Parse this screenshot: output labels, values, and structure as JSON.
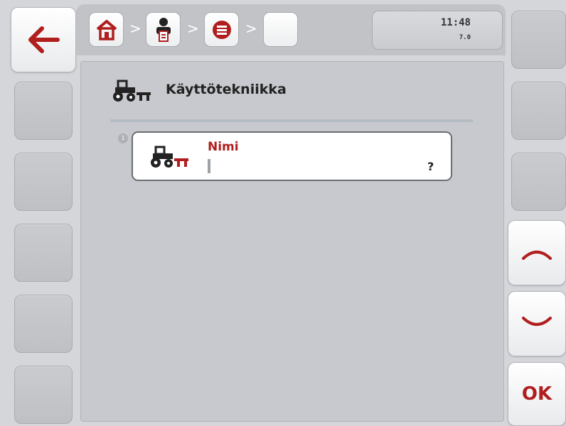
{
  "header": {
    "clock_time": "11:48",
    "version": "7.0"
  },
  "breadcrumb": {
    "items": [
      "home-icon",
      "operator-icon",
      "list-icon",
      "empty"
    ],
    "separator": ">"
  },
  "section": {
    "title": "Käyttötekniikka",
    "icon": "tractor-icon"
  },
  "field": {
    "index": "1",
    "label": "Nimi",
    "value": "",
    "help": "?",
    "icon": "tractor-icon"
  },
  "softkeys": {
    "left_top": "back-arrow-icon",
    "right_scroll_up": "chevron-up-icon",
    "right_scroll_down": "chevron-down-icon",
    "ok_label": "OK"
  },
  "colors": {
    "accent_red": "#b01e1e",
    "background": "#d4d6da",
    "panel": "#c8c9ce"
  }
}
